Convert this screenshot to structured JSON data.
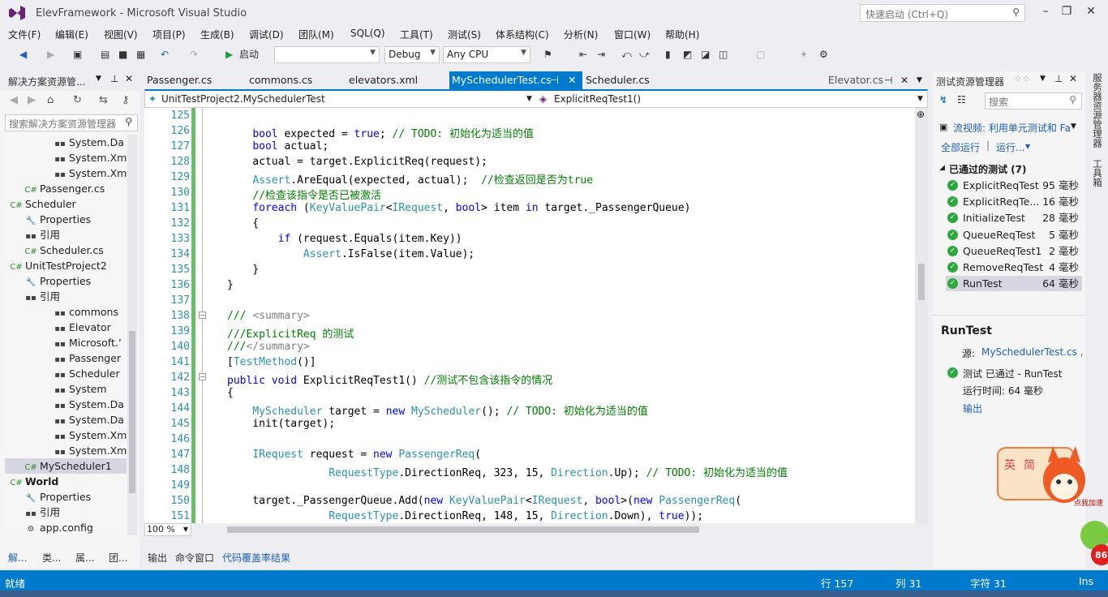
{
  "window": {
    "title": "ElevFramework - Microsoft Visual Studio",
    "quick_launch_placeholder": "快速启动 (Ctrl+Q)"
  },
  "menu": [
    "文件(F)",
    "编辑(E)",
    "视图(V)",
    "项目(P)",
    "生成(B)",
    "调试(D)",
    "团队(M)",
    "SQL(Q)",
    "工具(T)",
    "测试(S)",
    "体系结构(C)",
    "分析(N)",
    "窗口(W)",
    "帮助(H)"
  ],
  "toolbar": {
    "start_label": "启动",
    "config": "Debug",
    "platform": "Any CPU"
  },
  "solution_explorer": {
    "title": "解决方案资源管...",
    "search_placeholder": "搜索解决方案资源管理器",
    "nodes": [
      {
        "label": "System.Da",
        "kind": "ref"
      },
      {
        "label": "System.Xm",
        "kind": "ref"
      },
      {
        "label": "System.Xm",
        "kind": "ref"
      },
      {
        "label": "Passenger.cs",
        "kind": "cs"
      },
      {
        "label": "Scheduler",
        "kind": "proj"
      },
      {
        "label": "Properties",
        "kind": "props"
      },
      {
        "label": "引用",
        "kind": "refs"
      },
      {
        "label": "Scheduler.cs",
        "kind": "cs"
      },
      {
        "label": "UnitTestProject2",
        "kind": "proj"
      },
      {
        "label": "Properties",
        "kind": "props"
      },
      {
        "label": "引用",
        "kind": "refs"
      },
      {
        "label": "commons",
        "kind": "ref"
      },
      {
        "label": "Elevator",
        "kind": "ref"
      },
      {
        "label": "Microsoft.’",
        "kind": "ref"
      },
      {
        "label": "Passenger",
        "kind": "ref"
      },
      {
        "label": "Scheduler",
        "kind": "ref"
      },
      {
        "label": "System",
        "kind": "ref"
      },
      {
        "label": "System.Da",
        "kind": "ref"
      },
      {
        "label": "System.Da",
        "kind": "ref"
      },
      {
        "label": "System.Xm",
        "kind": "ref"
      },
      {
        "label": "System.Xm",
        "kind": "ref"
      },
      {
        "label": "MyScheduler1",
        "kind": "cs"
      },
      {
        "label": "World",
        "kind": "proj"
      },
      {
        "label": "Properties",
        "kind": "props"
      },
      {
        "label": "引用",
        "kind": "refs"
      },
      {
        "label": "app.config",
        "kind": "cfg"
      }
    ],
    "bottom_tabs": [
      "解...",
      "类...",
      "属...",
      "团..."
    ]
  },
  "editor": {
    "tabs": [
      "Passenger.cs",
      "commons.cs",
      "elevators.xml",
      "MySchedulerTest.cs",
      "Scheduler.cs",
      "Elevator.cs"
    ],
    "active_tab": "MySchedulerTest.cs",
    "nav_class": "UnitTestProject2.MySchedulerTest",
    "nav_member": "ExplicitReqTest1()",
    "zoom": "100 %",
    "lines": [
      {
        "n": "125",
        "t": ""
      },
      {
        "n": "126",
        "t": "    bool expected = true; // TODO: 初始化为适当的值"
      },
      {
        "n": "127",
        "t": "    bool actual;"
      },
      {
        "n": "128",
        "t": "    actual = target.ExplicitReq(request);"
      },
      {
        "n": "129",
        "t": "    Assert.AreEqual(expected, actual);  //检查返回是否为true"
      },
      {
        "n": "130",
        "t": "    //检查该指令是否已被激活"
      },
      {
        "n": "131",
        "t": "    foreach (KeyValuePair<IRequest, bool> item in target._PassengerQueue)"
      },
      {
        "n": "132",
        "t": "    {"
      },
      {
        "n": "133",
        "t": "        if (request.Equals(item.Key))"
      },
      {
        "n": "134",
        "t": "            Assert.IsFalse(item.Value);"
      },
      {
        "n": "135",
        "t": "    }"
      },
      {
        "n": "136",
        "t": "}"
      },
      {
        "n": "137",
        "t": ""
      },
      {
        "n": "138",
        "t": "/// <summary>"
      },
      {
        "n": "139",
        "t": "///ExplicitReq 的测试"
      },
      {
        "n": "140",
        "t": "///</summary>"
      },
      {
        "n": "141",
        "t": "[TestMethod()]"
      },
      {
        "n": "142",
        "t": "public void ExplicitReqTest1() //测试不包含该指令的情况"
      },
      {
        "n": "143",
        "t": "{"
      },
      {
        "n": "144",
        "t": "    MyScheduler target = new MyScheduler(); // TODO: 初始化为适当的值"
      },
      {
        "n": "145",
        "t": "    init(target);"
      },
      {
        "n": "146",
        "t": ""
      },
      {
        "n": "147",
        "t": "    IRequest request = new PassengerReq("
      },
      {
        "n": "148",
        "t": "                RequestType.DirectionReq, 323, 15, Direction.Up); // TODO: 初始化为适当的值"
      },
      {
        "n": "149",
        "t": ""
      },
      {
        "n": "150",
        "t": "    target._PassengerQueue.Add(new KeyValuePair<IRequest, bool>(new PassengerReq("
      },
      {
        "n": "151",
        "t": "                RequestType.DirectionReq, 148, 15, Direction.Down), true));"
      }
    ],
    "output_tabs": [
      "输出",
      "命令窗口",
      "代码覆盖率结果"
    ]
  },
  "test_explorer": {
    "title": "测试资源管理器",
    "search_placeholder": "搜索",
    "stream_link": "流视频: 利用单元测试和 Fa",
    "run_all": "全部运行",
    "run": "运行...",
    "group_header": "已通过的测试 (7)",
    "tests": [
      {
        "name": "ExplicitReqTest",
        "time": "95 毫秒"
      },
      {
        "name": "ExplicitReqTe...",
        "time": "16 毫秒"
      },
      {
        "name": "InitializeTest",
        "time": "28 毫秒"
      },
      {
        "name": "QueueReqTest",
        "time": "5 毫秒"
      },
      {
        "name": "QueueReqTest1",
        "time": "2 毫秒"
      },
      {
        "name": "RemoveReqTest",
        "time": "4 毫秒"
      },
      {
        "name": "RunTest",
        "time": "64 毫秒"
      }
    ],
    "detail": {
      "title": "RunTest",
      "source_label": "源:",
      "source_link": "MySchedulerTest.cs ,",
      "result": "测试 已通过 - RunTest",
      "elapsed": "运行时间: 64 毫秒",
      "output_link": "输出"
    },
    "rail_labels": [
      "服务器资源管理器",
      "工具箱"
    ]
  },
  "status": {
    "ready": "就绪",
    "line": "行 157",
    "col": "列 31",
    "char": "字符 31",
    "mode": "Ins"
  },
  "mascot": {
    "badge_left": "英",
    "badge_right": "简",
    "caption": "点我加速",
    "number": "86"
  },
  "colors": {
    "accent": "#007acc",
    "keyword": "#0000ff",
    "comment": "#008000",
    "type": "#2b91af",
    "pass": "#2da83f"
  }
}
